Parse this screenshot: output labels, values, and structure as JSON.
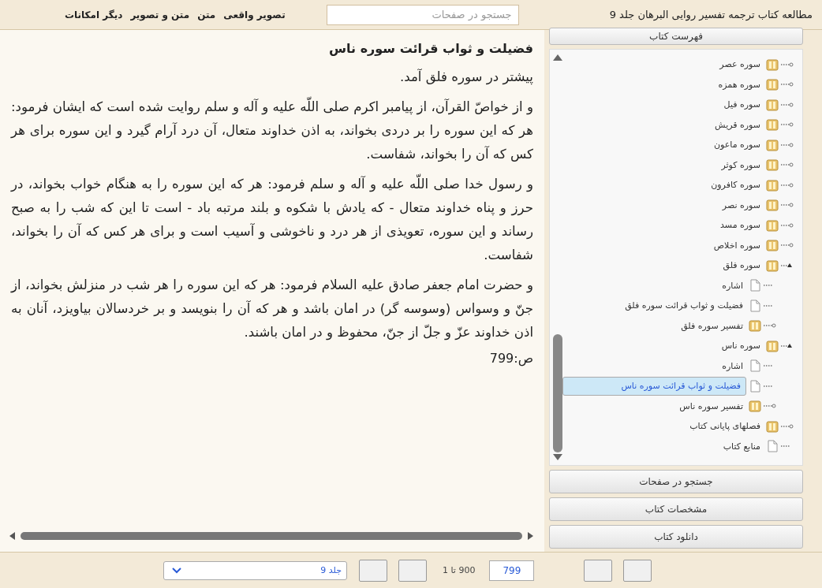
{
  "header": {
    "title": "مطالعه کتاب ترجمه تفسیر روایی البرهان جلد 9",
    "search": {
      "placeholder": "جستجو در صفحات"
    },
    "menu": [
      "تصویر واقعی",
      "متن",
      "متن و تصویر",
      "دیگر امکانات"
    ]
  },
  "content": {
    "heading": "فضیلت و ثواب قرائت سوره ناس",
    "paragraphs": [
      "پیشتر در سوره فلق آمد.",
      "و از خواصّ القرآن، از پیامبر اکرم صلی اللّه علیه و آله و سلم روایت شده است که ایشان فرمود: هر که این سوره را بر دردی بخواند، به اذن خداوند متعال، آن درد آرام گیرد و این سوره برای هر کس که آن را بخواند، شفاست.",
      "و رسول خدا صلی اللّه علیه و آله و سلم فرمود: هر که این سوره را به هنگام خواب بخواند، در حرز و پناه خداوند متعال - که یادش با شکوه و بلند مرتبه باد - است تا این که شب را به صبح رساند و این سوره، تعویذی از هر درد و ناخوشی و آسیب است و برای هر کس که آن را بخواند، شفاست.",
      "و حضرت امام جعفر صادق علیه السلام فرمود: هر که این سوره را هر شب در منزلش بخواند، از جنّ و وسواس (وسوسه گر) در امان باشد و هر که آن را بنویسد و بر خردسالان بیاویزد، آنان به اذن خداوند عزّ و جلّ از جنّ، محفوظ و در امان  باشند."
    ],
    "page_number": "ص:799"
  },
  "sidebar": {
    "toc_header": "فهرست کتاب",
    "tree": [
      {
        "label": "سوره عصر",
        "kind": "folder",
        "expanded": false,
        "selected": false
      },
      {
        "label": "سوره همزه",
        "kind": "folder",
        "expanded": false,
        "selected": false
      },
      {
        "label": "سوره فیل",
        "kind": "folder",
        "expanded": false,
        "selected": false
      },
      {
        "label": "سوره قریش",
        "kind": "folder",
        "expanded": false,
        "selected": false
      },
      {
        "label": "سوره ماعون",
        "kind": "folder",
        "expanded": false,
        "selected": false
      },
      {
        "label": "سوره کوثر",
        "kind": "folder",
        "expanded": false,
        "selected": false
      },
      {
        "label": "سوره کافرون",
        "kind": "folder",
        "expanded": false,
        "selected": false
      },
      {
        "label": "سوره نصر",
        "kind": "folder",
        "expanded": false,
        "selected": false
      },
      {
        "label": "سوره مسد",
        "kind": "folder",
        "expanded": false,
        "selected": false
      },
      {
        "label": "سوره اخلاص",
        "kind": "folder",
        "expanded": false,
        "selected": false
      },
      {
        "label": "سوره فلق",
        "kind": "folder",
        "expanded": true,
        "selected": false,
        "children": [
          {
            "label": "اشاره",
            "kind": "page",
            "selected": false
          },
          {
            "label": "فضیلت و ثواب قرائت سوره فلق",
            "kind": "page",
            "selected": false
          },
          {
            "label": "تفسیر سوره فلق",
            "kind": "folder",
            "expanded": false,
            "selected": false
          }
        ]
      },
      {
        "label": "سوره ناس",
        "kind": "folder",
        "expanded": true,
        "selected": false,
        "children": [
          {
            "label": "اشاره",
            "kind": "page",
            "selected": false
          },
          {
            "label": "فضیلت و ثواب قرائت سوره ناس",
            "kind": "page",
            "selected": true
          },
          {
            "label": "تفسیر سوره ناس",
            "kind": "folder",
            "expanded": false,
            "selected": false
          }
        ]
      },
      {
        "label": "فصلهای پایانی کتاب",
        "kind": "folder",
        "expanded": false,
        "selected": false
      },
      {
        "label": "منابع کتاب",
        "kind": "page",
        "selected": false
      }
    ],
    "buttons": [
      "جستجو در صفحات",
      "مشخصات کتاب",
      "دانلود کتاب"
    ]
  },
  "footer": {
    "volume_select": "جلد 9",
    "page_range": "900 تا 1",
    "page_input": "799"
  }
}
